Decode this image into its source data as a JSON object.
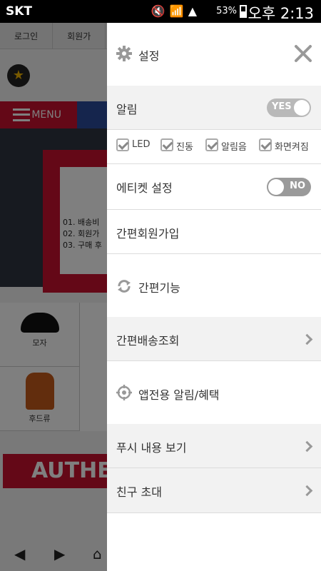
{
  "status_bar": {
    "carrier": "SKT",
    "icons": [
      "mute-icon",
      "wifi-icon",
      "signal-icon"
    ],
    "battery": "53%",
    "time": "오후 2:13"
  },
  "background_page": {
    "top_nav": [
      "로그인",
      "회원가"
    ],
    "menu_label": "MENU",
    "banner_lines": [
      "01. 배송비",
      "02. 회원가",
      "03. 구매 후"
    ],
    "grid": [
      {
        "label": "모자",
        "icon": "cap-icon"
      },
      {
        "label": "후드류",
        "icon": "hoodie-icon"
      }
    ],
    "authentic_text": "AUTHEN",
    "bottom_nav_icons": [
      "back-icon",
      "forward-icon",
      "home-icon"
    ]
  },
  "drawer": {
    "header": {
      "icon": "gear-icon",
      "title": "설정",
      "close_icon": "close-icon"
    },
    "notification": {
      "label": "알림",
      "toggle": "YES"
    },
    "options": [
      {
        "label": "LED",
        "checked": true
      },
      {
        "label": "진동",
        "checked": true
      },
      {
        "label": "알림음",
        "checked": true
      },
      {
        "label": "화면켜짐",
        "checked": true
      }
    ],
    "etiquette": {
      "label": "에티켓 설정",
      "toggle": "NO"
    },
    "quick_signup": "간편회원가입",
    "quick_functions": {
      "icon": "refresh-icon",
      "label": "간편기능"
    },
    "delivery_lookup": "간편배송조회",
    "app_alerts": {
      "icon": "target-icon",
      "label": "앱전용 알림/혜택"
    },
    "push_view": "푸시 내용 보기",
    "invite_friends": "친구 초대",
    "colors": {
      "header_bg": "#f2f2f2",
      "divider": "#dcdcdc",
      "toggle_on": "#b9b9b9",
      "toggle_off": "#9a9a9a"
    }
  }
}
